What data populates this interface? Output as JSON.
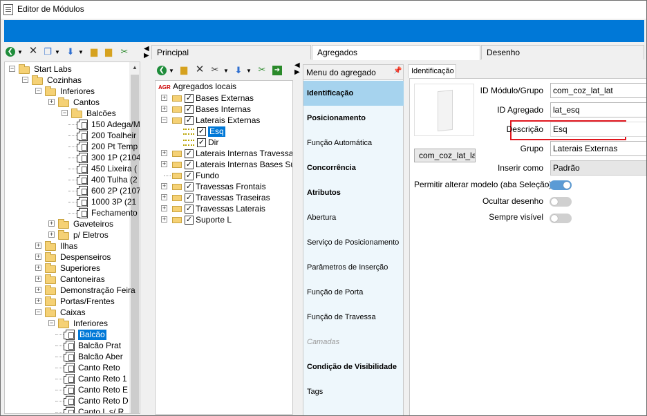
{
  "window": {
    "title": "Editor de Módulos"
  },
  "tree": {
    "items": [
      {
        "label": "Start Labs"
      },
      {
        "label": "Cozinhas"
      },
      {
        "label": "Inferiores"
      },
      {
        "label": "Cantos"
      },
      {
        "label": "Balcões"
      },
      {
        "label": "150 Adega/M"
      },
      {
        "label": "200 Toalheir"
      },
      {
        "label": "200 Pt Temp"
      },
      {
        "label": "300 1P (2104"
      },
      {
        "label": "450 Lixeira ("
      },
      {
        "label": "400 Tulha (2"
      },
      {
        "label": "600 2P (2107"
      },
      {
        "label": "1000 3P (21"
      },
      {
        "label": "Fechamento"
      },
      {
        "label": "Gaveteiros"
      },
      {
        "label": "p/ Eletros"
      },
      {
        "label": "Ilhas"
      },
      {
        "label": "Despenseiros"
      },
      {
        "label": "Superiores"
      },
      {
        "label": "Cantoneiras"
      },
      {
        "label": "Demonstração Feira"
      },
      {
        "label": "Portas/Frentes"
      },
      {
        "label": "Caixas"
      },
      {
        "label": "Inferiores"
      },
      {
        "label": "Balcão"
      },
      {
        "label": "Balcão Prat"
      },
      {
        "label": "Balcão Aber"
      },
      {
        "label": "Canto Reto"
      },
      {
        "label": "Canto Reto 1"
      },
      {
        "label": "Canto Reto E"
      },
      {
        "label": "Canto Reto D"
      },
      {
        "label": "Canto L s/ R"
      }
    ]
  },
  "main_tabs": [
    {
      "label": "Principal"
    },
    {
      "label": "Agregados"
    },
    {
      "label": "Desenho"
    }
  ],
  "aggregates": {
    "root": "Agregados locais",
    "root_badge": "AGR",
    "items": [
      {
        "label": "Bases Externas",
        "checked": "✓"
      },
      {
        "label": "Bases Internas",
        "checked": "✓"
      },
      {
        "label": "Laterais Externas",
        "checked": "✓"
      },
      {
        "label": "Esq",
        "checked": "✓"
      },
      {
        "label": "Dir",
        "checked": "✓"
      },
      {
        "label": "Laterais Internas Travessas",
        "checked": "✓"
      },
      {
        "label": "Laterais Internas Bases Sup",
        "checked": "✓"
      },
      {
        "label": "Fundo",
        "checked": "✓"
      },
      {
        "label": "Travessas Frontais",
        "checked": "✓"
      },
      {
        "label": "Travessas Traseiras",
        "checked": "✓"
      },
      {
        "label": "Travessas Laterais",
        "checked": "✓"
      },
      {
        "label": "Suporte L",
        "checked": "✓"
      }
    ]
  },
  "agg_menu": {
    "header": "Menu do agregado",
    "items": [
      {
        "label": "Identificação"
      },
      {
        "label": "Posicionamento"
      },
      {
        "label": "Função Automática"
      },
      {
        "label": "Concorrência"
      },
      {
        "label": "Atributos"
      },
      {
        "label": "Abertura"
      },
      {
        "label": "Serviço de Posicionamento"
      },
      {
        "label": "Parâmetros de Inserção"
      },
      {
        "label": "Função de Porta"
      },
      {
        "label": "Função de Travessa"
      },
      {
        "label": "Camadas"
      },
      {
        "label": "Condição de Visibilidade"
      },
      {
        "label": "Tags"
      }
    ]
  },
  "ident": {
    "tab": "Identificação",
    "preview_caption": "com_coz_lat_la",
    "fields": {
      "modulo_label": "ID Módulo/Grupo",
      "modulo_value": "com_coz_lat_lat",
      "agregado_label": "ID Agregado",
      "agregado_value": "lat_esq",
      "descricao_label": "Descrição",
      "descricao_value": "Esq",
      "grupo_label": "Grupo",
      "grupo_value": "Laterais Externas",
      "inserir_label": "Inserir como",
      "inserir_value": "Padrão"
    },
    "toggles": {
      "permitir_label": "Permitir alterar modelo (aba Seleção)",
      "permitir_on": true,
      "ocultar_label": "Ocultar desenho",
      "ocultar_on": false,
      "visivel_label": "Sempre visível",
      "visivel_on": false
    },
    "highlight_color": "#e0161e"
  },
  "colors": {
    "ribbon": "#0078d7",
    "selection": "#0078d7",
    "menu_active": "#a6d3ee"
  }
}
